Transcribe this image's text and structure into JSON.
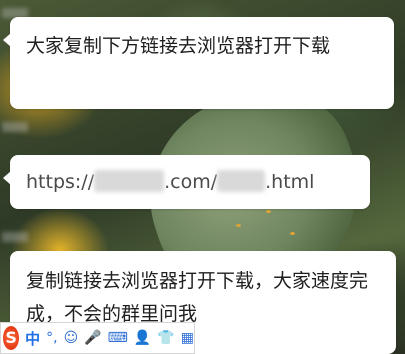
{
  "messages": [
    {
      "text": "大家复制下方链接去浏览器打开下载"
    },
    {
      "url_prefix": "https://",
      "url_mid": ".com/",
      "url_suffix": ".html"
    },
    {
      "text": "复制链接去浏览器打开下载，大家速度完成，不会的群里问我"
    }
  ],
  "ime": {
    "logo": "S",
    "mode": "中",
    "punct": "°,",
    "icons": [
      "emoji-icon",
      "microphone-icon",
      "keyboard-icon",
      "user-icon",
      "shirt-icon",
      "apps-icon"
    ]
  }
}
